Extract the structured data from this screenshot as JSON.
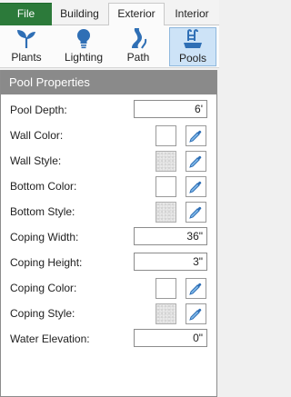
{
  "tabs": {
    "file": "File",
    "building": "Building",
    "exterior": "Exterior",
    "interior": "Interior"
  },
  "ribbon": {
    "plants": "Plants",
    "lighting": "Lighting",
    "path": "Path",
    "pools": "Pools"
  },
  "panel": {
    "title": "Pool Properties",
    "pool_depth_label": "Pool Depth:",
    "pool_depth_value": "6'",
    "wall_color_label": "Wall Color:",
    "wall_style_label": "Wall Style:",
    "bottom_color_label": "Bottom Color:",
    "bottom_style_label": "Bottom Style:",
    "coping_width_label": "Coping Width:",
    "coping_width_value": "36\"",
    "coping_height_label": "Coping Height:",
    "coping_height_value": "3\"",
    "coping_color_label": "Coping Color:",
    "coping_style_label": "Coping Style:",
    "water_elevation_label": "Water Elevation:",
    "water_elevation_value": "0\""
  },
  "colors": {
    "file_tab": "#2c7a3a",
    "selected_ribbon": "#cde3f7",
    "panel_header": "#8a8a8a",
    "icon_blue": "#2f6fb5"
  },
  "icons": {
    "plants": "sprout-icon",
    "lighting": "lightbulb-icon",
    "path": "path-icon",
    "pools": "pool-ladder-icon",
    "picker": "eyedropper-icon"
  }
}
